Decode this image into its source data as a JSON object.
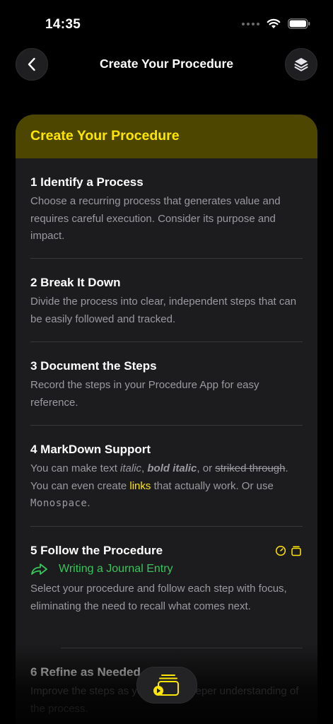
{
  "status_bar": {
    "time": "14:35"
  },
  "nav": {
    "title": "Create Your Procedure",
    "back_icon": "chevron-left-icon",
    "layers_icon": "layers-icon"
  },
  "card": {
    "header": "Create Your Procedure",
    "sections": [
      {
        "title": "1 Identify a Process",
        "body": "Choose a recurring process that generates value and requires careful execution. Consider its purpose and impact."
      },
      {
        "title": "2 Break It Down",
        "body": "Divide the process into clear, independent steps that can be easily followed and tracked."
      },
      {
        "title": "3 Document the Steps",
        "body": "Record the steps in your Procedure App for easy reference."
      },
      {
        "title": "4 MarkDown Support",
        "body_parts": {
          "p1": "You can make text ",
          "italic": "italic",
          "p2": ", ",
          "bold_italic": "bold italic",
          "p3": ", or ",
          "striked": "striked through",
          "p4": ". You can even create ",
          "link": "links",
          "p5": " that actually work. Or use ",
          "mono": "Monospace",
          "p6": "."
        }
      },
      {
        "title": "5 Follow the Procedure",
        "link_label": "Writing a Journal Entry",
        "body": "Select your procedure and follow each step with focus, eliminating the need to recall what comes next."
      },
      {
        "title": "6 Refine as Needed",
        "body": "Improve the steps as you gain a deeper understanding of the process."
      }
    ]
  },
  "colors": {
    "accent": "#ffe600",
    "header_bg": "#4d4600",
    "green": "#39c55c",
    "card_bg": "#1c1c1e"
  }
}
